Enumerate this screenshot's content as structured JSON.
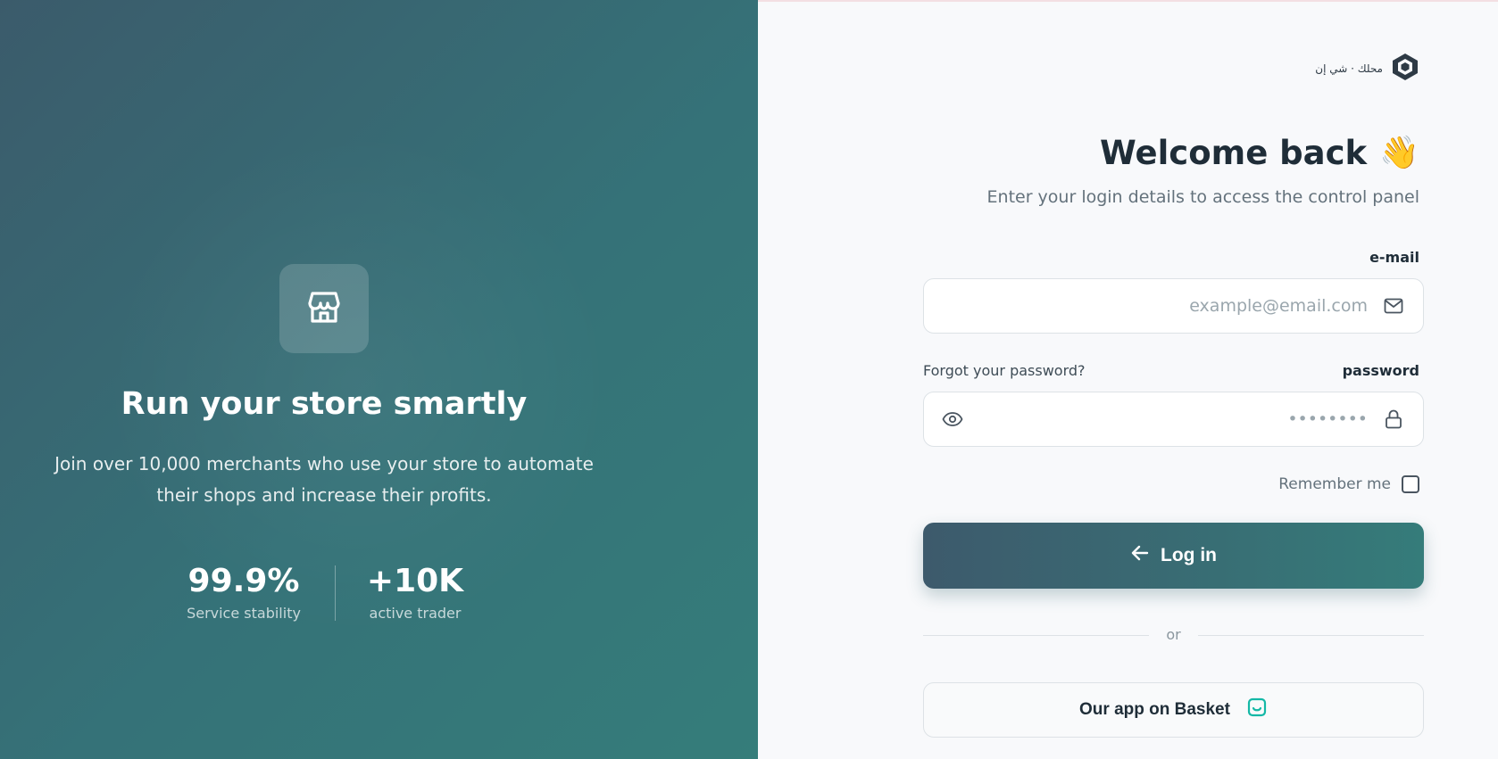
{
  "hero": {
    "title": "Run your store smartly",
    "description": "Join over 10,000 merchants who use your store to automate their shops and increase their profits.",
    "stats": [
      {
        "value": "99.9%",
        "label": "Service stability"
      },
      {
        "value": "+10K",
        "label": "active trader"
      }
    ]
  },
  "brand": {
    "text": "محلك · شي إن"
  },
  "login": {
    "title": "Welcome back",
    "emoji": "👋",
    "subtitle": "Enter your login details to access the control panel",
    "email_label": "e-mail",
    "email_placeholder": "example@email.com",
    "password_label": "password",
    "password_placeholder": "••••••••",
    "forgot_password": "Forgot your password?",
    "remember_me": "Remember me",
    "login_button": "Log in",
    "or_text": "or",
    "app_button": "Our app on Basket"
  },
  "colors": {
    "primary_dark": "#3d5a6c",
    "primary_teal": "#357c7a",
    "basket_icon": "#14b8a6"
  }
}
